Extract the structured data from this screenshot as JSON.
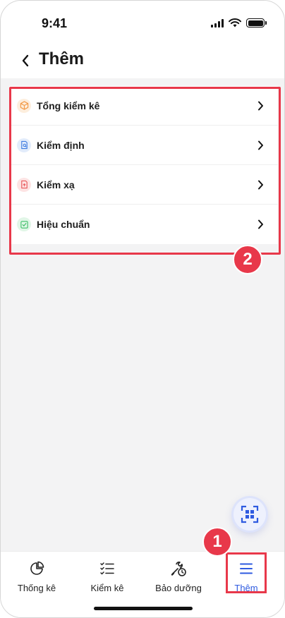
{
  "status_bar": {
    "time": "9:41"
  },
  "header": {
    "title": "Thêm",
    "back_icon": "chevron-left-icon"
  },
  "menu": {
    "items": [
      {
        "label": "Tổng kiểm kê",
        "icon": "box-icon",
        "color": "#f39c4a",
        "bg": "#fdeedd"
      },
      {
        "label": "Kiểm định",
        "icon": "document-search-icon",
        "color": "#3d7be0",
        "bg": "#e2ecfb"
      },
      {
        "label": "Kiểm xạ",
        "icon": "radiation-doc-icon",
        "color": "#e8575a",
        "bg": "#fde3e3"
      },
      {
        "label": "Hiệu chuẩn",
        "icon": "edit-check-icon",
        "color": "#3fbf69",
        "bg": "#e1f6e7"
      }
    ]
  },
  "annotations": {
    "step_1": "1",
    "step_2": "2",
    "highlight_color": "#e8384a"
  },
  "fab": {
    "icon": "qr-scan-icon",
    "color": "#2f5be0"
  },
  "bottom_nav": {
    "items": [
      {
        "label": "Thống kê",
        "icon": "pie-chart-icon",
        "active": false
      },
      {
        "label": "Kiểm kê",
        "icon": "checklist-icon",
        "active": false
      },
      {
        "label": "Bảo dưỡng",
        "icon": "wrench-clock-icon",
        "active": false
      },
      {
        "label": "Thêm",
        "icon": "menu-icon",
        "active": true
      }
    ],
    "active_color": "#2f5be0"
  }
}
